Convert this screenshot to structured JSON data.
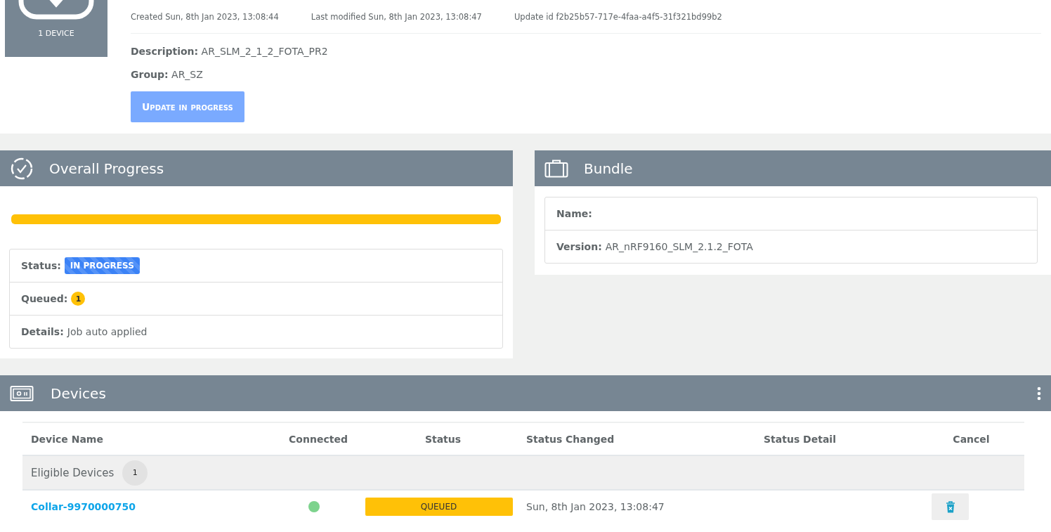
{
  "summary": {
    "device_count": "1 DEVICE",
    "created": "Created Sun, 8th Jan 2023, 13:08:44",
    "modified": "Last modified Sun, 8th Jan 2023, 13:08:47",
    "update_id": "Update id f2b25b57-717e-4faa-a4f5-31f321bd99b2",
    "fields": [
      {
        "label": "Description:",
        "value": "AR_SLM_2_1_2_FOTA_PR2"
      },
      {
        "label": "Group:",
        "value": "AR_SZ"
      }
    ],
    "button": {
      "label": "Update in progress",
      "disabled": true
    }
  },
  "overall_progress": {
    "title": "Overall Progress",
    "level": 1,
    "status_label": "Status:",
    "status": "IN PROGRESS",
    "queued_label": "Queued:",
    "queued": "1",
    "details_label": "Details:",
    "details": "Job auto applied"
  },
  "bundle": {
    "title": "Bundle",
    "fields": [
      {
        "label": "Name:"
      },
      {
        "label": "Version:",
        "value": "AR_nRF9160_SLM_2.1.2_FOTA"
      }
    ]
  },
  "devices": {
    "title": "Devices",
    "columns": [
      "Device Name",
      "Connected",
      "Status",
      "Status Changed",
      "Status Detail",
      "Cancel"
    ],
    "group": {
      "label": "Eligible Devices",
      "count": "1"
    },
    "rows": [
      {
        "name": "Collar-9970000750",
        "connected": true,
        "status": "QUEUED",
        "status_changed": "Sun, 8th Jan 2023, 13:08:47"
      }
    ]
  }
}
